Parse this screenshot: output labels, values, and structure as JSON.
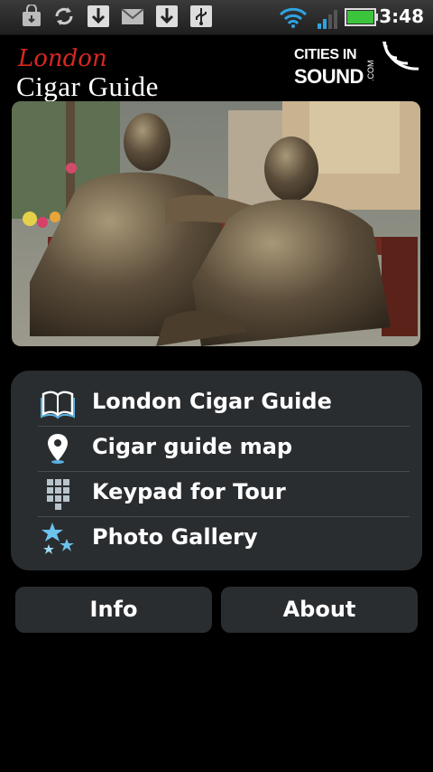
{
  "status_bar": {
    "time": "3:48",
    "icons": [
      "shopping-bag-icon",
      "sync-icon",
      "download-icon",
      "mail-icon",
      "download-icon",
      "usb-icon",
      "wifi-icon",
      "signal-icon",
      "battery-icon"
    ],
    "battery_color": "#3cc43c",
    "wifi_color": "#2fa3e0",
    "signal_color": "#2fa3e0"
  },
  "header": {
    "logo_line1": "London",
    "logo_line2": "Cigar Guide",
    "partner_line1": "CITIES IN",
    "partner_line2": "SOUND",
    "partner_suffix": ".COM",
    "logo_accent": "#d8281f"
  },
  "hero": {
    "image": "statue-photo"
  },
  "menu": {
    "items": [
      {
        "label": "London Cigar Guide",
        "icon": "book-icon"
      },
      {
        "label": "Cigar guide map",
        "icon": "map-pin-icon"
      },
      {
        "label": "Keypad for Tour",
        "icon": "keypad-icon"
      },
      {
        "label": "Photo Gallery",
        "icon": "stars-icon"
      }
    ]
  },
  "buttons": {
    "info": "Info",
    "about": "About"
  }
}
